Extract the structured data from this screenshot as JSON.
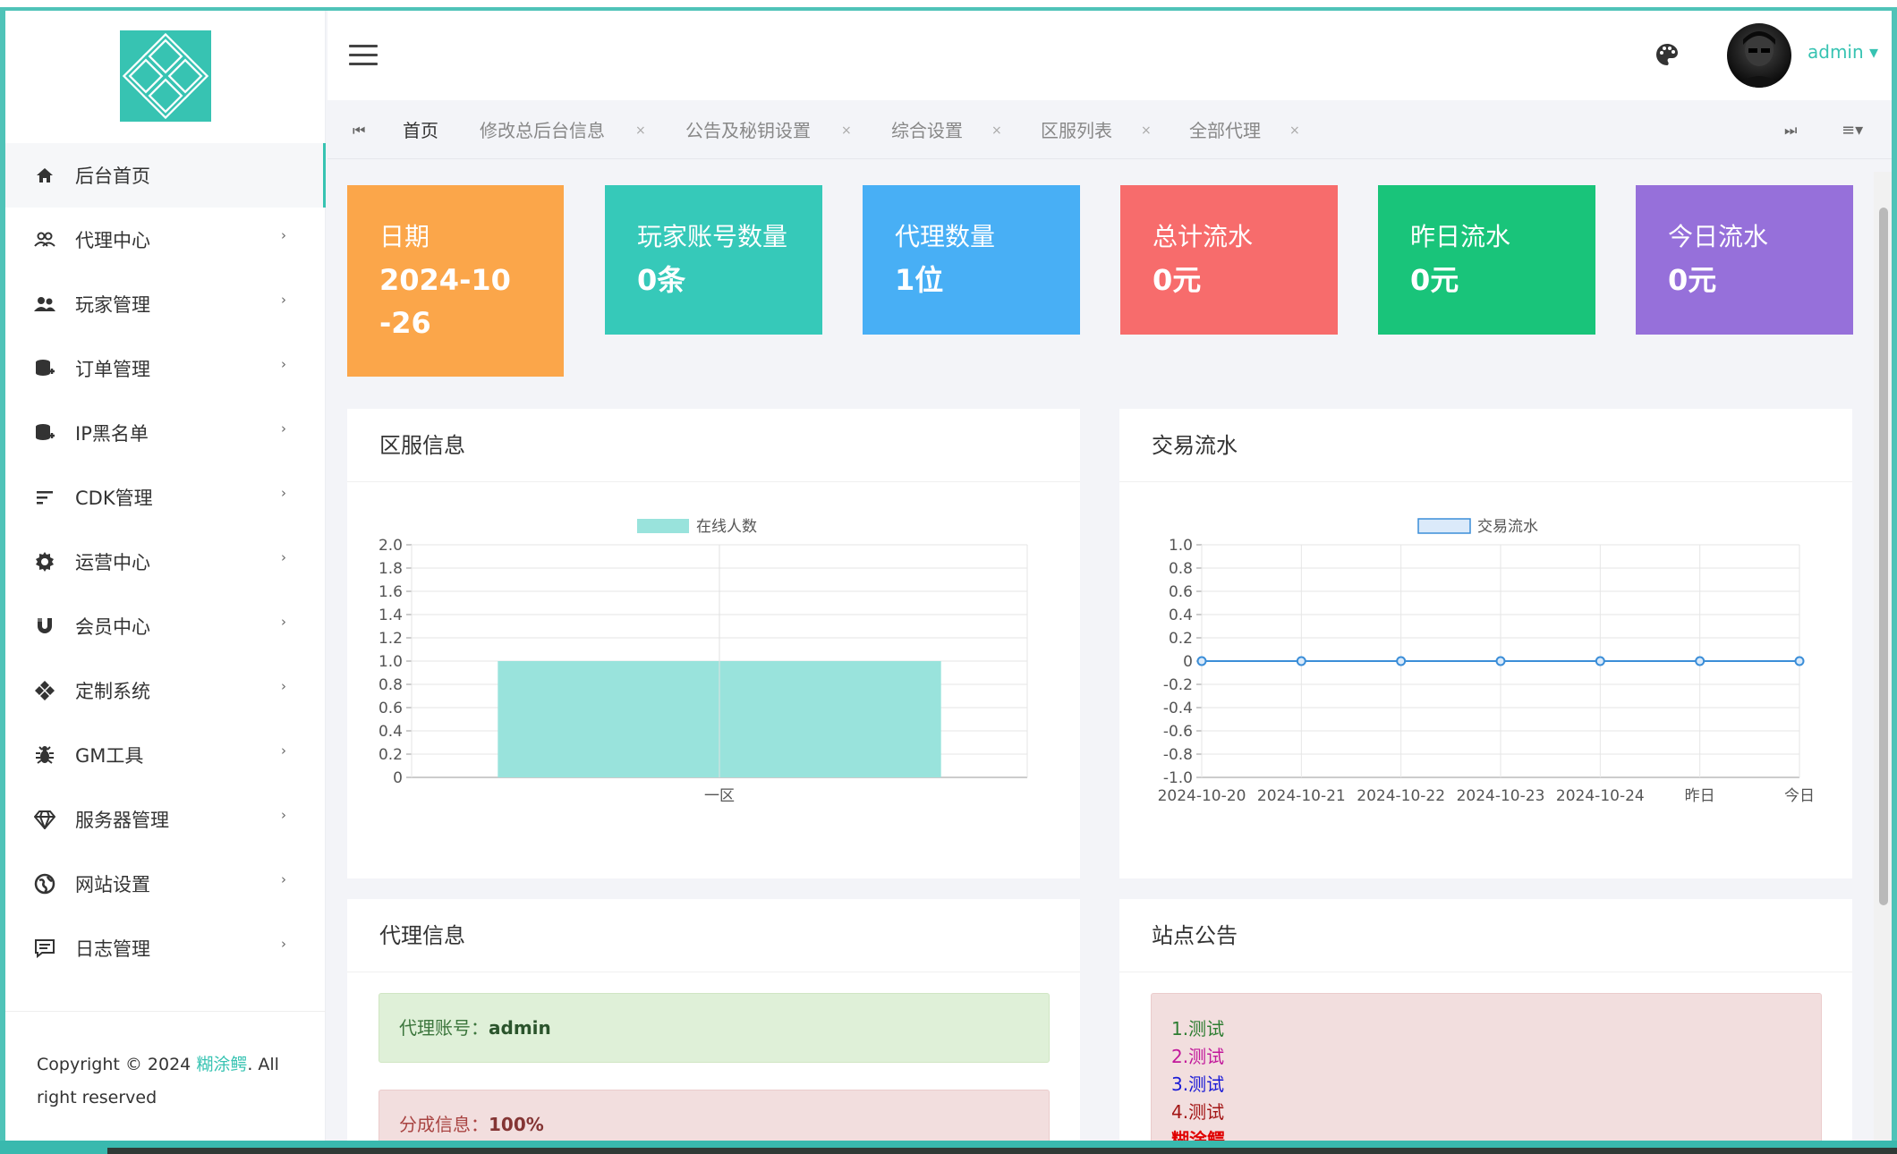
{
  "sidebar": {
    "items": [
      {
        "label": "后台首页",
        "icon": "home-icon"
      },
      {
        "label": "代理中心",
        "icon": "users-icon"
      },
      {
        "label": "玩家管理",
        "icon": "group-icon"
      },
      {
        "label": "订单管理",
        "icon": "database-plus-icon"
      },
      {
        "label": "IP黑名单",
        "icon": "database-plus-icon"
      },
      {
        "label": "CDK管理",
        "icon": "sort-icon"
      },
      {
        "label": "运营中心",
        "icon": "gear-icon"
      },
      {
        "label": "会员中心",
        "icon": "magnet-icon"
      },
      {
        "label": "定制系统",
        "icon": "diamonds-icon"
      },
      {
        "label": "GM工具",
        "icon": "bug-icon"
      },
      {
        "label": "服务器管理",
        "icon": "gem-icon"
      },
      {
        "label": "网站设置",
        "icon": "globe-icon"
      },
      {
        "label": "日志管理",
        "icon": "comment-icon"
      }
    ],
    "copyright_prefix": "Copyright © 2024 ",
    "copyright_brand": "糊涂鳄",
    "copyright_suffix": ". All right reserved"
  },
  "header": {
    "user": "admin ▾"
  },
  "tabs": [
    {
      "label": "首页"
    },
    {
      "label": "修改总后台信息",
      "close": "×"
    },
    {
      "label": "公告及秘钥设置",
      "close": "×"
    },
    {
      "label": "综合设置",
      "close": "×"
    },
    {
      "label": "区服列表",
      "close": "×"
    },
    {
      "label": "全部代理",
      "close": "×"
    }
  ],
  "cards": [
    {
      "title": "日期",
      "value": "2024-10-26",
      "color": "#fba64a"
    },
    {
      "title": "玩家账号数量",
      "value": "0条",
      "color": "#36c9b9"
    },
    {
      "title": "代理数量",
      "value": "1位",
      "color": "#48aff5"
    },
    {
      "title": "总计流水",
      "value": "0元",
      "color": "#f76c6c"
    },
    {
      "title": "昨日流水",
      "value": "0元",
      "color": "#19c47a"
    },
    {
      "title": "今日流水",
      "value": "0元",
      "color": "#9670da"
    }
  ],
  "panels": {
    "server_title": "区服信息",
    "trade_title": "交易流水",
    "agent_title": "代理信息",
    "notice_title": "站点公告",
    "agent_account_label": "代理账号：",
    "agent_account_value": "admin",
    "agent_share_label": "分成信息：",
    "agent_share_value": "100%",
    "notices": [
      "1.测试",
      "2.测试",
      "3.测试",
      "4.测试",
      "糊涂鳄"
    ]
  },
  "chart_data": [
    {
      "type": "bar",
      "categories": [
        "一区"
      ],
      "series": [
        {
          "name": "在线人数",
          "values": [
            1
          ]
        }
      ],
      "ylim": [
        0,
        2
      ],
      "yticks": [
        "0",
        "0.2",
        "0.4",
        "0.6",
        "0.8",
        "1.0",
        "1.2",
        "1.4",
        "1.6",
        "1.8",
        "2.0"
      ],
      "grid": true,
      "legend": "top-center",
      "color": "#99e3dc"
    },
    {
      "type": "line",
      "categories": [
        "2024-10-20",
        "2024-10-21",
        "2024-10-22",
        "2024-10-23",
        "2024-10-24",
        "昨日",
        "今日"
      ],
      "series": [
        {
          "name": "交易流水",
          "values": [
            0,
            0,
            0,
            0,
            0,
            0,
            0
          ]
        }
      ],
      "ylim": [
        -1,
        1
      ],
      "yticks": [
        "-1.0",
        "-0.8",
        "-0.6",
        "-0.4",
        "-0.2",
        "0",
        "0.2",
        "0.4",
        "0.6",
        "0.8",
        "1.0"
      ],
      "grid": true,
      "legend": "top-center",
      "color": "#3b8ed8"
    }
  ]
}
